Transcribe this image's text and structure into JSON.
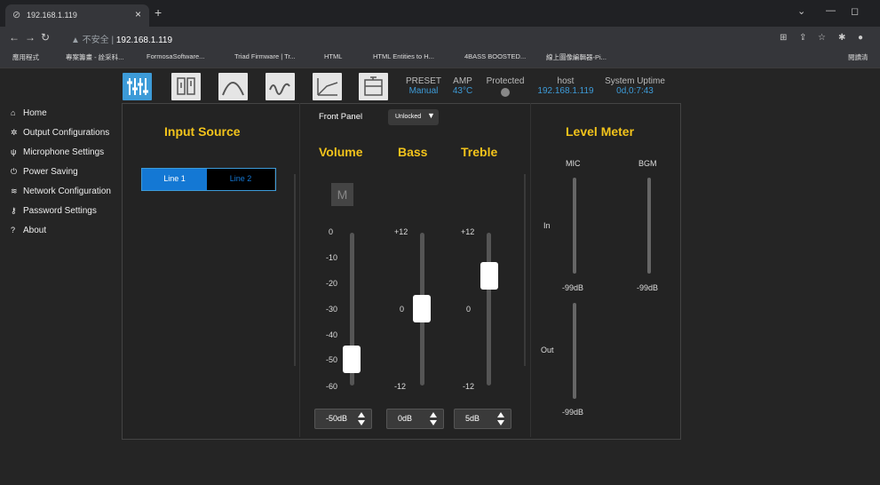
{
  "browser": {
    "tab_title": "192.168.1.119",
    "tab_close": "×",
    "new_tab": "+",
    "insecure_label": "▲ 不安全 |",
    "url": "192.168.1.119",
    "bookmarks": [
      "應用程式",
      "專案籌畫 - 詮采科...",
      "FormosaSoftware...",
      "Triad Firmware | Tr...",
      "HTML",
      "HTML Entities to H...",
      "4BASS BOOSTED...",
      "線上圖像編輯器-Pi..."
    ],
    "reading_list": "閱讀清"
  },
  "sidebar": {
    "items": [
      {
        "icon": "home-icon",
        "label": "Home"
      },
      {
        "icon": "gear-icon",
        "label": "Output Configurations"
      },
      {
        "icon": "microphone-icon",
        "label": "Microphone Settings"
      },
      {
        "icon": "power-icon",
        "label": "Power Saving"
      },
      {
        "icon": "wifi-icon",
        "label": "Network Configuration"
      },
      {
        "icon": "key-icon",
        "label": "Password Settings"
      },
      {
        "icon": "question-icon",
        "label": "About"
      }
    ]
  },
  "header_info": {
    "preset_label": "PRESET",
    "preset_value": "Manual",
    "amp_label": "AMP",
    "amp_value": "43°C",
    "protected_label": "Protected",
    "host_label": "host",
    "host_value": "192.168.1.119",
    "uptime_label": "System Uptime",
    "uptime_value": "0d,0:7:43"
  },
  "input_source": {
    "title": "Input Source",
    "options": [
      "Line 1",
      "Line 2"
    ],
    "selected": "Line 1"
  },
  "front_panel": {
    "label": "Front Panel",
    "lock_state": "Unlocked"
  },
  "volume": {
    "title": "Volume",
    "mute_label": "M",
    "ticks": [
      "0",
      "-10",
      "-20",
      "-30",
      "-40",
      "-50",
      "-60"
    ],
    "value": "-50dB",
    "level_fraction": 0.17
  },
  "bass": {
    "title": "Bass",
    "tick_top": "+12",
    "tick_mid": "0",
    "tick_bottom": "-12",
    "value": "0dB",
    "level_fraction": 0.5
  },
  "treble": {
    "title": "Treble",
    "tick_top": "+12",
    "tick_mid": "0",
    "tick_bottom": "-12",
    "value": "5dB",
    "level_fraction": 0.71
  },
  "level_meter": {
    "title": "Level Meter",
    "mic_label": "MIC",
    "bgm_label": "BGM",
    "in_label": "In",
    "out_label": "Out",
    "mic_in_value": "-99dB",
    "bgm_in_value": "-99dB",
    "out_value": "-99dB"
  },
  "colors": {
    "accent": "#3d9bd8",
    "heading": "#f2c31b",
    "selected_button": "#1478d4"
  }
}
